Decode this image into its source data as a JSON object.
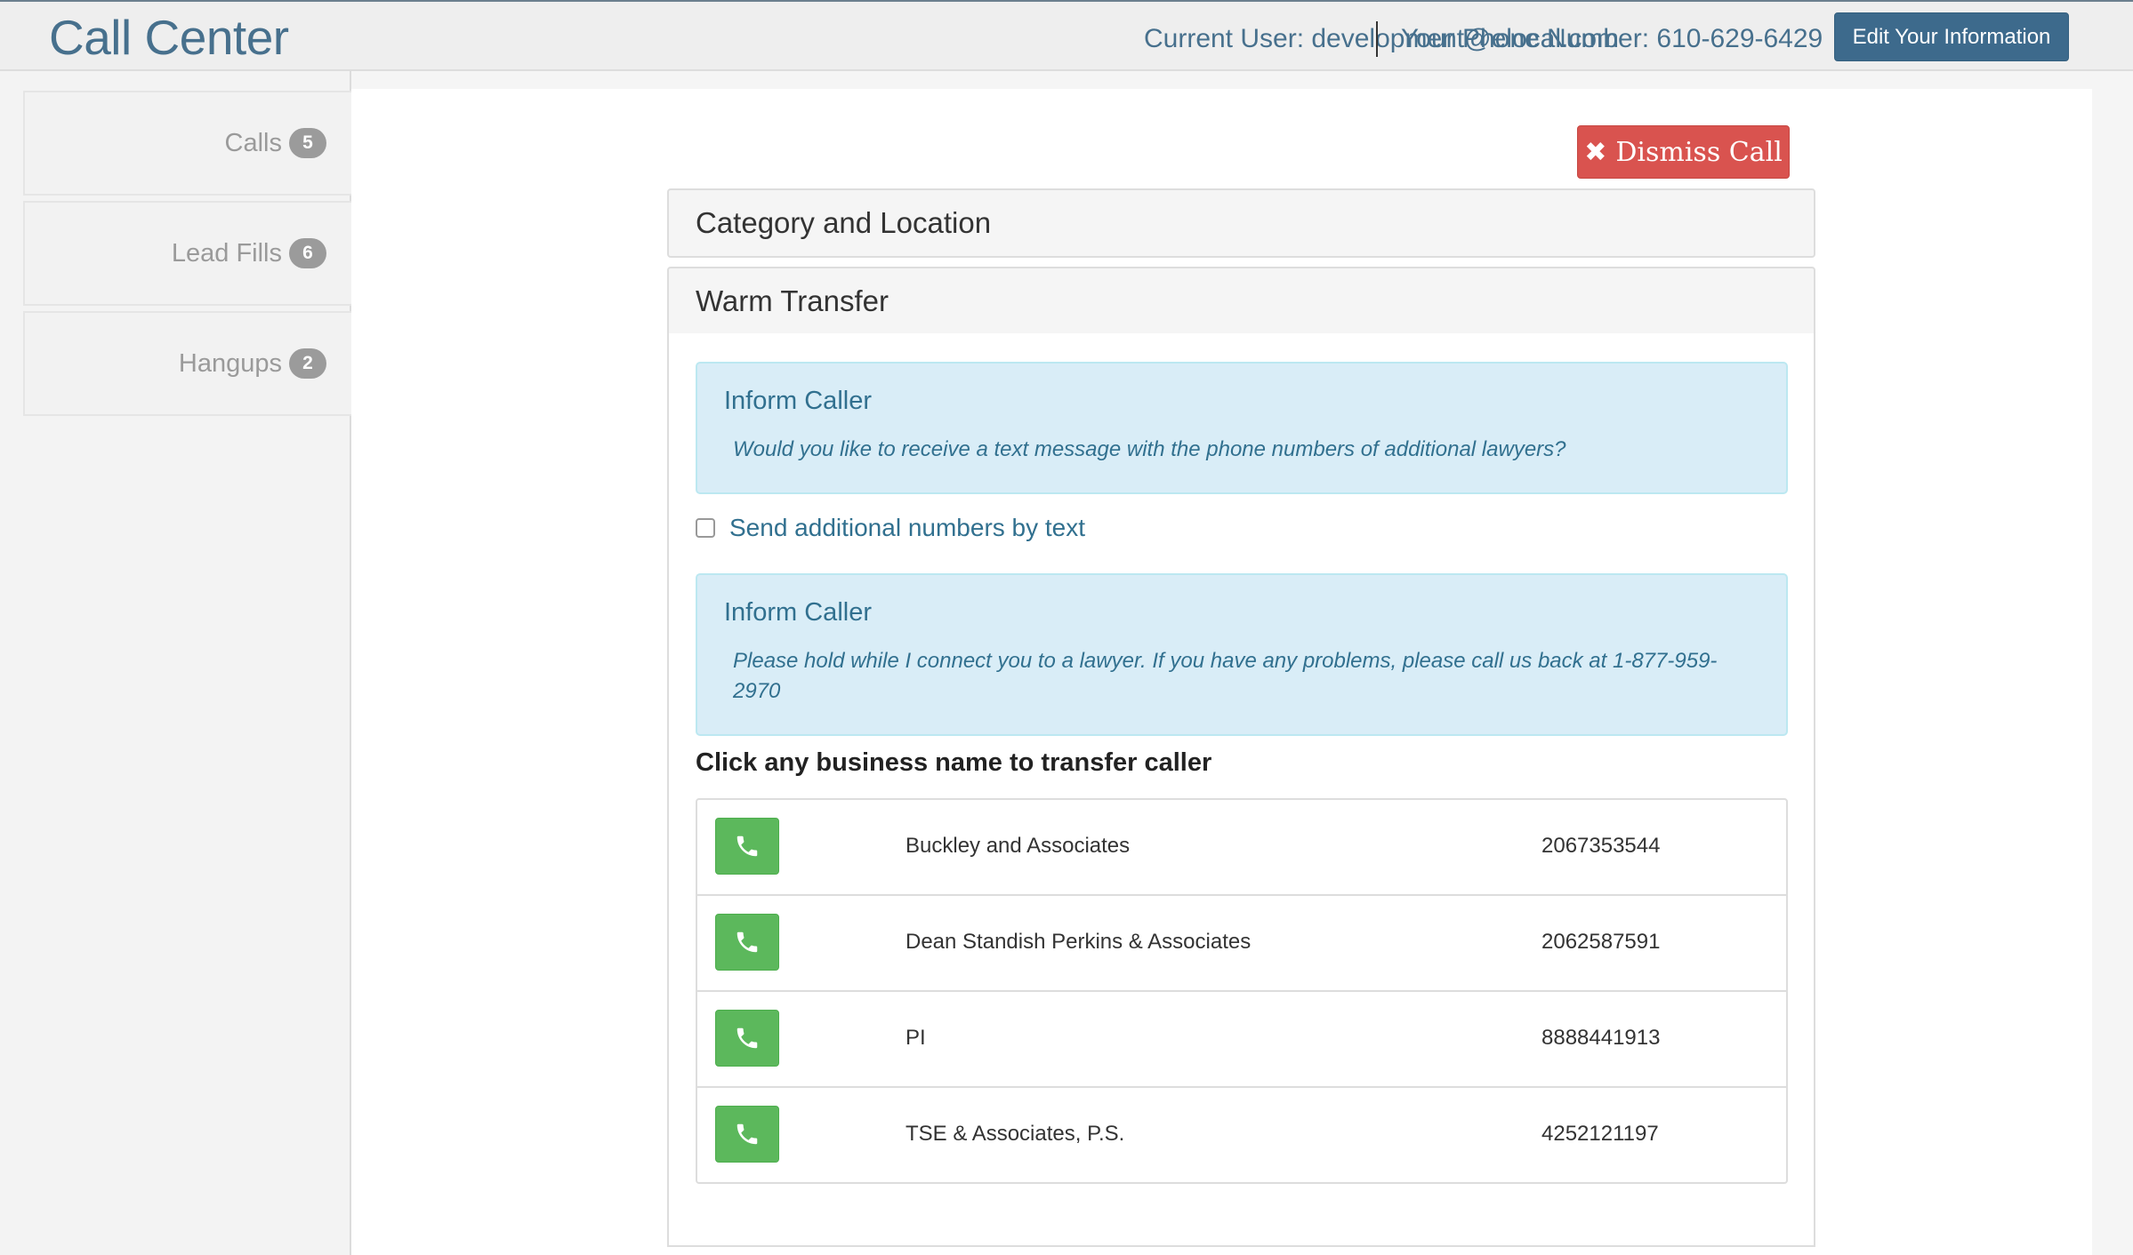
{
  "header": {
    "brand": "Call Center",
    "current_user": "Current User: development@elocal.com",
    "phone_number": "Your Phone Number: 610-629-6429",
    "edit_button": "Edit Your Information"
  },
  "sidebar": {
    "items": [
      {
        "label": "Calls",
        "count": "5"
      },
      {
        "label": "Lead Fills",
        "count": "6"
      },
      {
        "label": "Hangups",
        "count": "2"
      }
    ]
  },
  "main": {
    "dismiss_button": "Dismiss Call",
    "dismiss_icon": "times-icon",
    "panels": {
      "category_location": "Category and Location",
      "warm_transfer": "Warm Transfer"
    },
    "alerts": [
      {
        "title": "Inform Caller",
        "text": "Would you like to receive a text message with the phone numbers of additional lawyers?"
      },
      {
        "title": "Inform Caller",
        "text": "Please hold while I connect you to a lawyer. If you have any problems, please call us back at 1-877-959-2970"
      }
    ],
    "send_text_checkbox": {
      "label": "Send additional numbers by text",
      "checked": false
    },
    "transfer_heading": "Click any business name to transfer caller",
    "businesses": [
      {
        "name": "Buckley and Associates",
        "phone": "2067353544"
      },
      {
        "name": "Dean Standish Perkins & Associates",
        "phone": "2062587591"
      },
      {
        "name": "PI",
        "phone": "8888441913"
      },
      {
        "name": "TSE & Associates, P.S.",
        "phone": "4252121197"
      }
    ]
  },
  "colors": {
    "brand": "#47708d",
    "primary_button": "#3d6a8c",
    "danger": "#d9534f",
    "success": "#5cb85c",
    "info_bg": "#d9edf7",
    "info_text": "#31708f"
  }
}
